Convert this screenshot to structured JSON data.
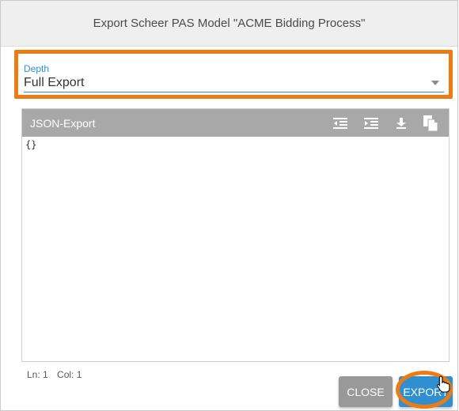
{
  "dialog": {
    "title": "Export Scheer PAS Model \"ACME Bidding Process\""
  },
  "depth": {
    "label": "Depth",
    "value": "Full Export"
  },
  "json_export": {
    "title": "JSON-Export",
    "content": "{}",
    "toolbar": [
      {
        "name": "unindent-icon"
      },
      {
        "name": "indent-icon"
      },
      {
        "name": "download-icon"
      },
      {
        "name": "copy-icon"
      }
    ]
  },
  "status": {
    "line": "Ln: 1",
    "col": "Col: 1"
  },
  "buttons": {
    "close": "CLOSE",
    "export": "EXPORT"
  },
  "colors": {
    "accent": "#2f8fd1",
    "highlight": "#ec7c12",
    "header_bar": "#a8a8a8",
    "close_button": "#999999"
  }
}
